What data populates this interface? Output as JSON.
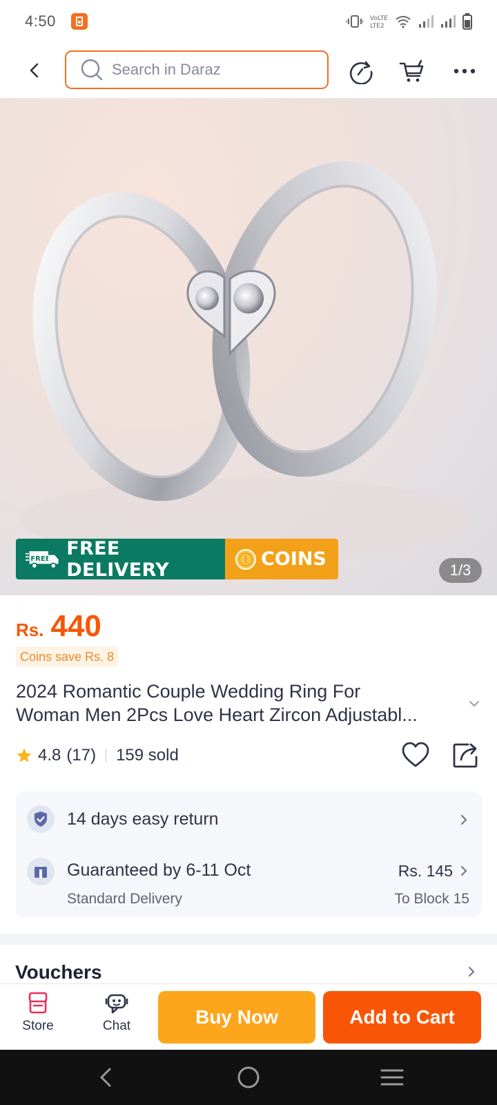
{
  "status_bar": {
    "time": "4:50"
  },
  "header": {
    "search_placeholder": "Search in Daraz",
    "icons": [
      "back-arrow-icon",
      "search-icon",
      "history-icon",
      "cart-icon",
      "more-icon"
    ]
  },
  "gallery": {
    "counter": "1/3",
    "badge_free": "FREE DELIVERY",
    "badge_free_icon_text": "FREE",
    "badge_coins": "COINS"
  },
  "product": {
    "currency": "Rs.",
    "price": "440",
    "coins_save": "Coins save Rs. 8",
    "title_line1": "2024 Romantic Couple Wedding Ring For",
    "title_line2": "Woman Men 2Pcs Love Heart Zircon Adjustabl...",
    "rating": "4.8",
    "rating_count": "(17)",
    "sold": "159 sold"
  },
  "services": {
    "return_text": "14 days easy return",
    "delivery_title": "Guaranteed by 6-11 Oct",
    "delivery_type": "Standard Delivery",
    "delivery_price": "Rs. 145",
    "delivery_location": "To Block 15"
  },
  "vouchers": {
    "title": "Vouchers"
  },
  "bottom_bar": {
    "store_label": "Store",
    "chat_label": "Chat",
    "buy_now": "Buy Now",
    "add_to_cart": "Add to Cart"
  },
  "colors": {
    "accent_orange": "#f85606",
    "buy_yellow": "#fda61c",
    "free_delivery_green": "#0a7a62",
    "coins_orange": "#f4a11a"
  }
}
